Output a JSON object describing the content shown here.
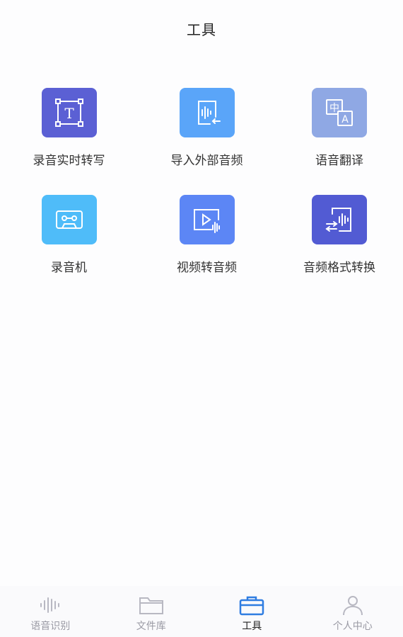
{
  "header": {
    "title": "工具"
  },
  "tools": [
    {
      "label": "录音实时转写",
      "icon": "text-frame-icon",
      "color": "#5b60d4"
    },
    {
      "label": "导入外部音频",
      "icon": "import-audio-icon",
      "color": "#5aa5f9"
    },
    {
      "label": "语音翻译",
      "icon": "translate-icon",
      "color": "#8fa8e4"
    },
    {
      "label": "录音机",
      "icon": "cassette-icon",
      "color": "#4fbcf9"
    },
    {
      "label": "视频转音频",
      "icon": "video-to-audio-icon",
      "color": "#5c86f5"
    },
    {
      "label": "音频格式转换",
      "icon": "audio-convert-icon",
      "color": "#525bd3"
    }
  ],
  "tabbar": {
    "items": [
      {
        "label": "语音识别",
        "icon": "waveform-icon",
        "active": false
      },
      {
        "label": "文件库",
        "icon": "folder-icon",
        "active": false
      },
      {
        "label": "工具",
        "icon": "toolbox-icon",
        "active": true
      },
      {
        "label": "个人中心",
        "icon": "person-icon",
        "active": false
      }
    ],
    "active_color": "#2f7de1",
    "inactive_color": "#b8b8c2"
  }
}
